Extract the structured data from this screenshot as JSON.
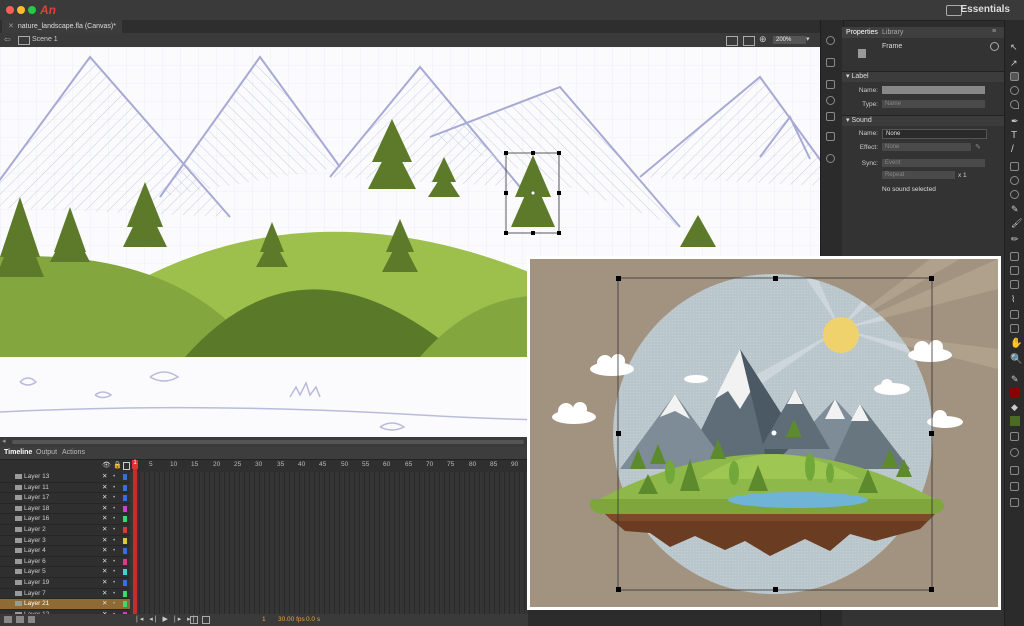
{
  "app": {
    "logo": "An",
    "workspace": "Essentials"
  },
  "document": {
    "tab_title": "nature_landscape.fla (Canvas)*",
    "scene": "Scene 1",
    "zoom": "200%"
  },
  "timeline": {
    "tabs": [
      "Timeline",
      "Output",
      "Actions"
    ],
    "ruler": [
      "1",
      "5",
      "10",
      "15",
      "20",
      "25",
      "30",
      "35",
      "40",
      "45",
      "50",
      "55",
      "60",
      "65",
      "70",
      "75",
      "80",
      "85",
      "90"
    ],
    "layers": [
      {
        "name": "Layer 13",
        "color": "#3b6fd8"
      },
      {
        "name": "Layer 11",
        "color": "#3b6fd8"
      },
      {
        "name": "Layer 17",
        "color": "#3b6fd8"
      },
      {
        "name": "Layer 18",
        "color": "#d83bd0"
      },
      {
        "name": "Layer 16",
        "color": "#3bd86a"
      },
      {
        "name": "Layer 2",
        "color": "#d83b3b"
      },
      {
        "name": "Layer 3",
        "color": "#d8c83b"
      },
      {
        "name": "Layer 4",
        "color": "#3b6fd8"
      },
      {
        "name": "Layer 6",
        "color": "#d83b8a"
      },
      {
        "name": "Layer 5",
        "color": "#3bd8d0"
      },
      {
        "name": "Layer 19",
        "color": "#3b6fd8"
      },
      {
        "name": "Layer 7",
        "color": "#3bd86a"
      },
      {
        "name": "Layer 21",
        "color": "#3bd86a"
      },
      {
        "name": "Layer 12",
        "color": "#d83bd0"
      },
      {
        "name": "Layer 8",
        "color": "#3b6fd8"
      }
    ],
    "selected_layer": "Layer 21",
    "frame_number": "1",
    "fps": "30.00 fps",
    "time": "0.0 s"
  },
  "properties": {
    "tabs": [
      "Properties",
      "Library"
    ],
    "type": "Frame",
    "label_section": "Label",
    "name_label": "Name:",
    "type_label": "Type:",
    "type_value": "Name",
    "sound_section": "Sound",
    "sound_name_label": "Name:",
    "sound_name_value": "None",
    "effect_label": "Effect:",
    "effect_value": "None",
    "sync_label": "Sync:",
    "sync_value": "Event",
    "repeat_value": "Repeat",
    "repeat_count": "x 1",
    "status": "No sound selected"
  },
  "colors": {
    "stroke": "#8b0000",
    "fill": "#4a6b22",
    "hill_light": "#9dbf4c",
    "hill_dark": "#5a7a2a",
    "overlay_bg": "#a29380"
  }
}
